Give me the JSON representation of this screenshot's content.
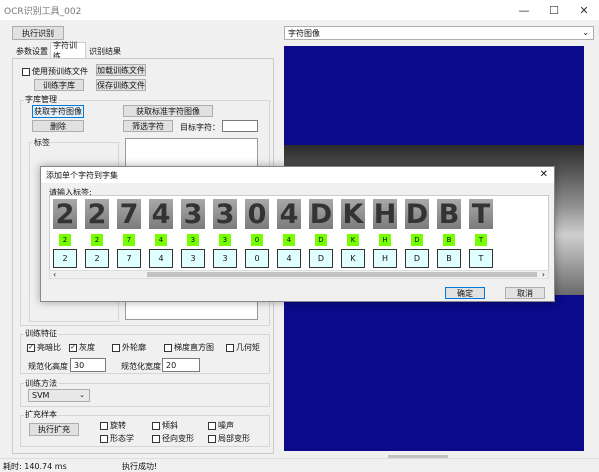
{
  "window": {
    "title": "OCR识别工具_002",
    "minimize": "—",
    "maximize": "☐",
    "close": "✕"
  },
  "toolbar": {
    "run_ocr": "执行识别"
  },
  "tabs": [
    "参数设置",
    "字符训练",
    "识别结果"
  ],
  "training": {
    "use_pretrained": "使用预训练文件",
    "load_training_file": "加载训练文件",
    "train_library": "训练字库",
    "save_training_file": "保存训练文件"
  },
  "library": {
    "group_title": "字库管理",
    "get_char_image": "获取字符图像",
    "get_standard_image": "获取标准字符图像",
    "delete": "删除",
    "filter_chars": "筛选字符",
    "target_char_label": "目标字符：",
    "target_char_value": "",
    "labels_group": "标签"
  },
  "features": {
    "group_title": "训练特征",
    "items": [
      {
        "label": "亮暗比",
        "checked": true
      },
      {
        "label": "灰度",
        "checked": true
      },
      {
        "label": "外轮廓",
        "checked": false
      },
      {
        "label": "梯度直方图",
        "checked": false
      },
      {
        "label": "几何矩",
        "checked": false
      }
    ],
    "norm_height_label": "规范化高度",
    "norm_height_value": "30",
    "norm_width_label": "规范化宽度",
    "norm_width_value": "20"
  },
  "method": {
    "group_title": "训练方法",
    "selected": "SVM"
  },
  "augment": {
    "group_title": "扩充样本",
    "run": "执行扩充",
    "options": [
      {
        "label": "旋转",
        "checked": false
      },
      {
        "label": "倾斜",
        "checked": false
      },
      {
        "label": "噪声",
        "checked": false
      },
      {
        "label": "形态学",
        "checked": false
      },
      {
        "label": "径向变形",
        "checked": false
      },
      {
        "label": "局部变形",
        "checked": false
      }
    ]
  },
  "status": {
    "time": "耗时: 140.74 ms",
    "message": "执行成功!"
  },
  "image_panel": {
    "selected": "字符图像",
    "accent": "#0a0a8a"
  },
  "dialog": {
    "title": "添加单个字符到字集",
    "prompt": "请输入标签:",
    "chars": [
      "2",
      "2",
      "7",
      "4",
      "3",
      "3",
      "0",
      "4",
      "D",
      "K",
      "H",
      "D",
      "B",
      "T"
    ],
    "confirm": "确定",
    "cancel": "取消"
  }
}
